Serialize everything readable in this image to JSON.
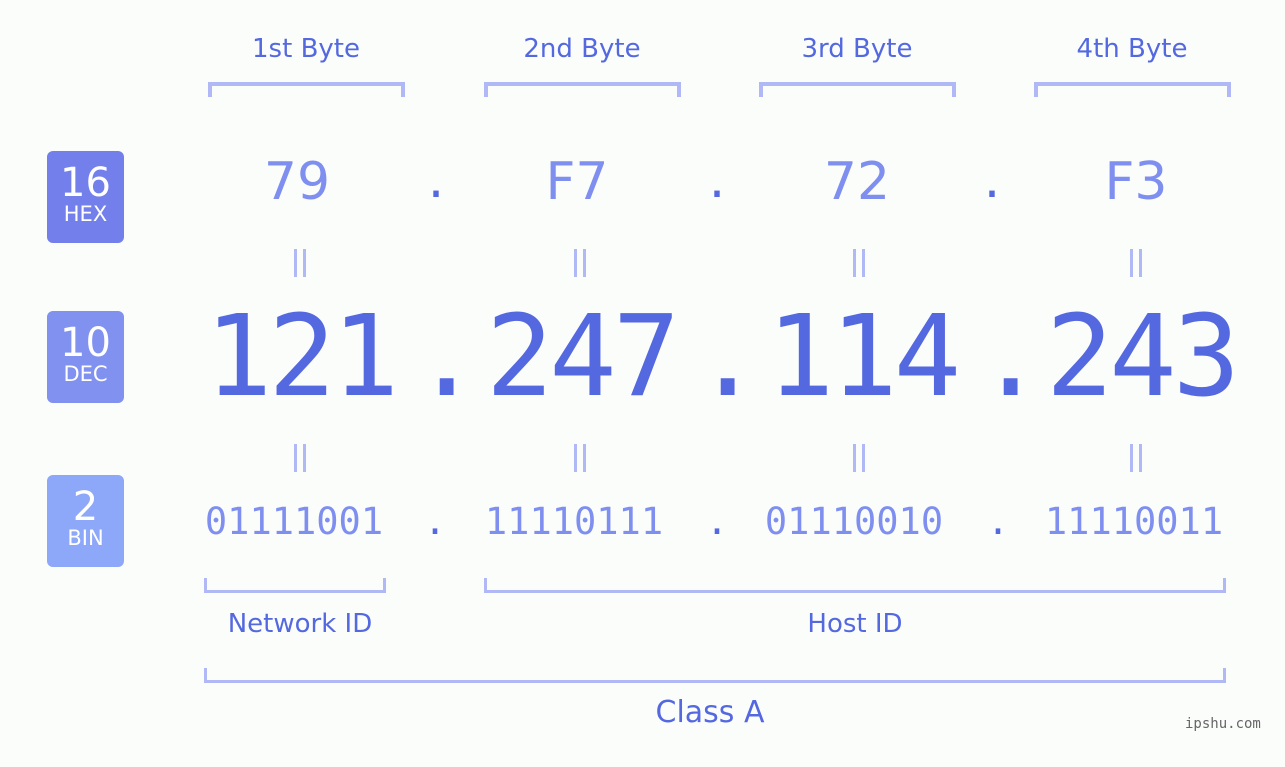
{
  "bases": {
    "hex": {
      "num": "16",
      "label": "HEX",
      "color": "#7380ec"
    },
    "dec": {
      "num": "10",
      "label": "DEC",
      "color": "#8091f0"
    },
    "bin": {
      "num": "2",
      "label": "BIN",
      "color": "#8da7f9"
    }
  },
  "byte_headers": [
    "1st Byte",
    "2nd Byte",
    "3rd Byte",
    "4th Byte"
  ],
  "hex_values": [
    "79",
    "F7",
    "72",
    "F3"
  ],
  "dec_values": [
    "121",
    "247",
    "114",
    "243"
  ],
  "bin_values": [
    "01111001",
    "11110111",
    "01110010",
    "11110011"
  ],
  "separator": ".",
  "segments": {
    "network_id": "Network ID",
    "host_id": "Host ID",
    "class": "Class A"
  },
  "watermark": "ipshu.com",
  "colors": {
    "accent": "#5468e0",
    "light_accent": "#7f8ff0",
    "bracket": "#b0b9f5",
    "background": "#fbfdfb"
  }
}
